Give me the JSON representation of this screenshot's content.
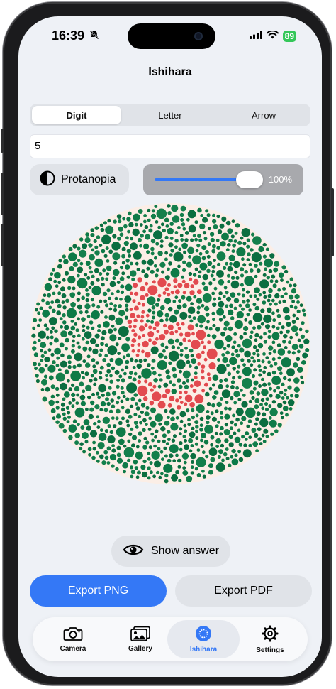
{
  "status": {
    "time": "16:39",
    "battery": "89"
  },
  "nav": {
    "title": "Ishihara"
  },
  "segments": [
    "Digit",
    "Letter",
    "Arrow"
  ],
  "selected_segment": "Digit",
  "digit_input": {
    "value": "5"
  },
  "simulation": {
    "label": "Protanopia"
  },
  "intensity": {
    "value": 1.0,
    "label": "100%"
  },
  "plate": {
    "digit": "5",
    "background_color": "#fbeee6",
    "figure_color": "#e24a4f",
    "field_colors": [
      "#0e7a47",
      "#147f4b",
      "#0b6e40"
    ]
  },
  "actions": {
    "show_answer": "Show answer",
    "export_png": "Export PNG",
    "export_pdf": "Export PDF"
  },
  "tabs": [
    {
      "label": "Camera",
      "icon": "camera-icon"
    },
    {
      "label": "Gallery",
      "icon": "photo-icon"
    },
    {
      "label": "Ishihara",
      "icon": "dotted-circle-icon"
    },
    {
      "label": "Settings",
      "icon": "gear-icon"
    }
  ],
  "active_tab": "Ishihara",
  "colors": {
    "accent": "#3478f6",
    "background": "#eef1f6"
  }
}
